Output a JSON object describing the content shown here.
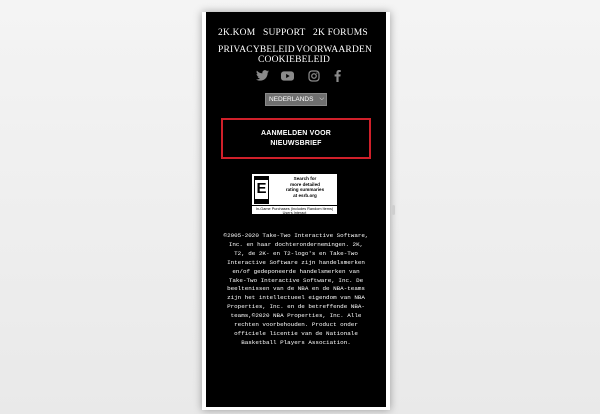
{
  "footer": {
    "nav_row1": [
      "2K.KOM",
      "SUPPORT",
      "2K FORUMS"
    ],
    "nav_row2": [
      "PRIVACYBELEID",
      "VOORWAARDEN"
    ],
    "nav_row3": [
      "COOKIEBELEID"
    ],
    "social_icons": [
      "twitter-icon",
      "youtube-icon",
      "instagram-icon",
      "facebook-icon"
    ],
    "icon_color": "#8a8a8a",
    "language_select": {
      "selected": "NEDERLANDS"
    },
    "newsletter_button": {
      "line1": "AANMELDEN VOOR",
      "line2": "NIEUWSBRIEF",
      "border_color": "#d0202a"
    },
    "esrb": {
      "rating_letter": "E",
      "text": [
        "Search for",
        "more detailed",
        "rating summaries",
        "at esrb.org"
      ],
      "footer_line1": "In-Game Purchases (Includes Random Items)",
      "footer_line2": "Users Interact"
    },
    "legal_text": "©2005-2020 Take-Two Interactive Software, Inc. en haar dochterondernemingen. 2K, T2, de 2K- en T2-logo's en Take-Two Interactive Software zijn handelsmerken en/of gedeponeerde handelsmerken van Take-Two Interactive Software, Inc. De beeltenissen van de NBA en de NBA-teams zijn het intellectueel eigendom van NBA Properties, Inc. en de betreffende NBA-teams,©2020 NBA Properties, Inc. Alle rechten voorbehouden. Product onder officiele licentie van de Nationale Basketball Players Association."
  }
}
